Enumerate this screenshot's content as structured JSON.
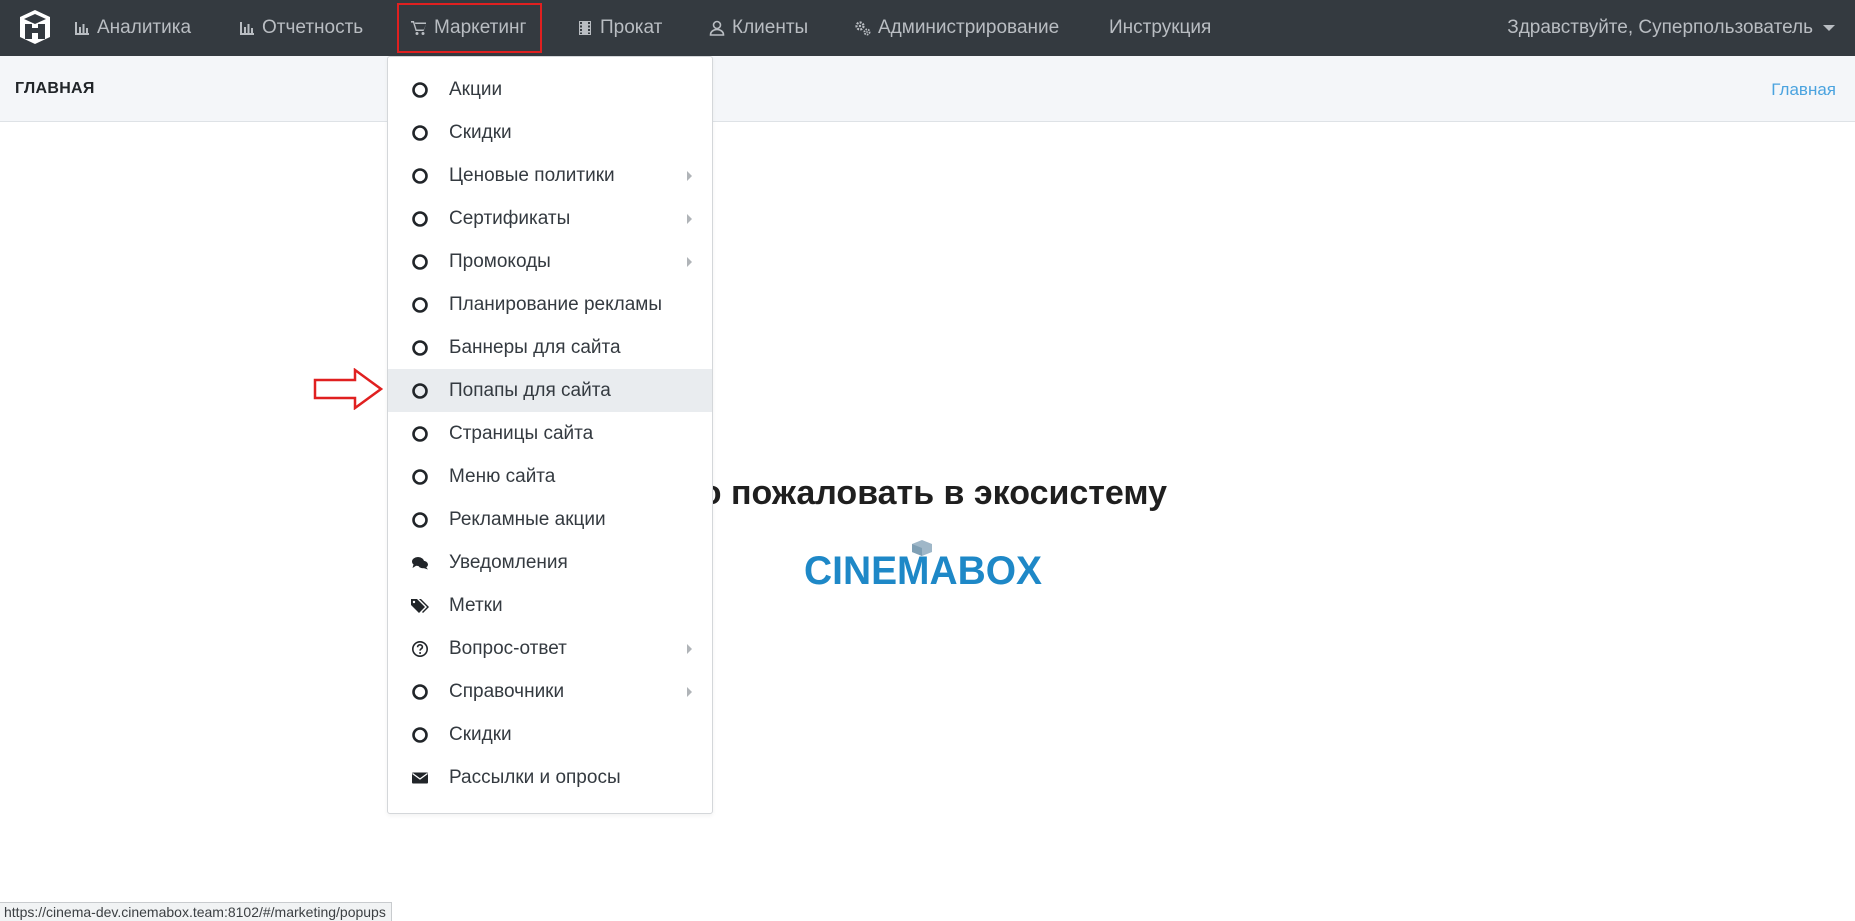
{
  "nav": {
    "items": [
      {
        "label": "Аналитика",
        "icon": "bar-chart-icon"
      },
      {
        "label": "Отчетность",
        "icon": "bar-chart-icon"
      },
      {
        "label": "Маркетинг",
        "icon": "cart-icon"
      },
      {
        "label": "Прокат",
        "icon": "film-icon"
      },
      {
        "label": "Клиенты",
        "icon": "user-icon"
      },
      {
        "label": "Администрирование",
        "icon": "gears-icon"
      },
      {
        "label": "Инструкция",
        "icon": ""
      }
    ],
    "user_greeting": "Здравствуйте, Суперпользователь"
  },
  "subheader": {
    "title": "ГЛАВНАЯ",
    "breadcrumb": "Главная"
  },
  "main": {
    "welcome_visible": "ро пожаловать в экосистему",
    "brand": "CINEMABOX",
    "brand_color": "#1e88c7"
  },
  "dropdown": {
    "items": [
      {
        "label": "Акции",
        "icon": "circle-outline-icon",
        "submenu": false
      },
      {
        "label": "Скидки",
        "icon": "circle-outline-icon",
        "submenu": false
      },
      {
        "label": "Ценовые политики",
        "icon": "circle-outline-icon",
        "submenu": true
      },
      {
        "label": "Сертификаты",
        "icon": "circle-outline-icon",
        "submenu": true
      },
      {
        "label": "Промокоды",
        "icon": "circle-outline-icon",
        "submenu": true
      },
      {
        "label": "Планирование рекламы",
        "icon": "circle-outline-icon",
        "submenu": false
      },
      {
        "label": "Баннеры для сайта",
        "icon": "circle-outline-icon",
        "submenu": false
      },
      {
        "label": "Попапы для сайта",
        "icon": "circle-outline-icon",
        "submenu": false,
        "highlighted": true
      },
      {
        "label": "Страницы сайта",
        "icon": "circle-outline-icon",
        "submenu": false
      },
      {
        "label": "Меню сайта",
        "icon": "circle-outline-icon",
        "submenu": false
      },
      {
        "label": "Рекламные акции",
        "icon": "circle-outline-icon",
        "submenu": false
      },
      {
        "label": "Уведомления",
        "icon": "comments-icon",
        "submenu": false
      },
      {
        "label": "Метки",
        "icon": "tags-icon",
        "submenu": false
      },
      {
        "label": "Вопрос-ответ",
        "icon": "question-circle-icon",
        "submenu": true
      },
      {
        "label": "Справочники",
        "icon": "circle-outline-icon",
        "submenu": true
      },
      {
        "label": "Скидки",
        "icon": "circle-outline-icon",
        "submenu": false
      },
      {
        "label": "Рассылки и опросы",
        "icon": "envelope-icon",
        "submenu": false
      }
    ]
  },
  "status_bar": {
    "url": "https://cinema-dev.cinemabox.team:8102/#/marketing/popups"
  },
  "colors": {
    "navbar": "#343a40",
    "annotation": "#e02020",
    "link": "#4aa3df"
  }
}
